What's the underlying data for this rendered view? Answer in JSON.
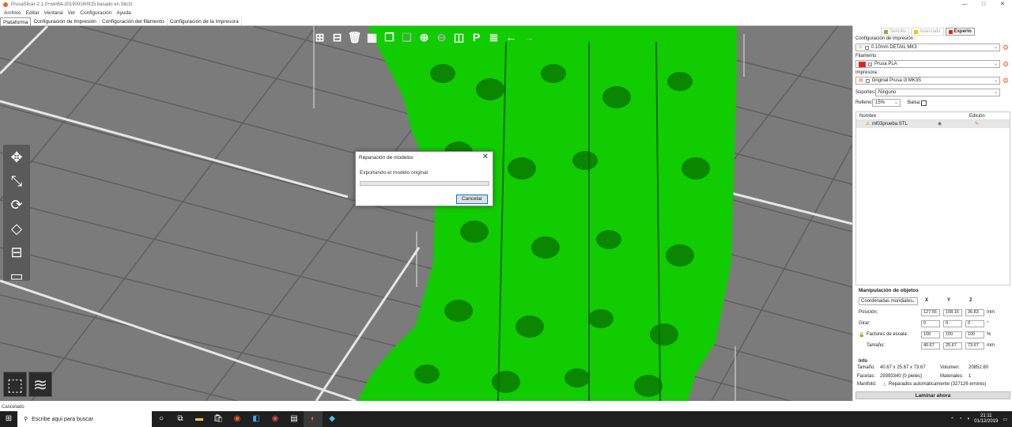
{
  "window": {
    "title": "PrusaSlicer-2.1.0+win64-201909160915 basado en Slic3r"
  },
  "menu": [
    "Archivo",
    "Editar",
    "Ventana",
    "Ver",
    "Configuración",
    "Ayuda"
  ],
  "tabs": [
    "Plataforma",
    "Configuración de Impresión",
    "Configuración del filamento",
    "Configuración de la Impresora"
  ],
  "dialog": {
    "title": "Reparación de modelos",
    "message": "Exportando el modelo original",
    "progress": 0,
    "cancel_label": "Cancelar"
  },
  "status": "Cancelado",
  "panel": {
    "modes": [
      {
        "label": "Sencillo",
        "color": "#6fbe42"
      },
      {
        "label": "Avanzado",
        "color": "#f2c200"
      },
      {
        "label": "Experto",
        "color": "#e0261a"
      }
    ],
    "print_settings_label": "Configuración de impresión :",
    "print_settings_value": "0.10mm DETAIL MK3",
    "filament_label": "Filamento :",
    "filament_value": "Prusa PLA",
    "filament_color": "#e0261a",
    "printer_label": "Impresora :",
    "printer_value": "Original Prusa i3 MK3S",
    "supports_label": "Soportes:",
    "supports_value": "Ninguno",
    "infill_label": "Relleno:",
    "infill_value": "15%",
    "brim_label": "Balsa:",
    "list_header_name": "Nombre",
    "list_header_edit": "Edición",
    "object_name": "mf03prueba.STL"
  },
  "manipulation": {
    "title": "Manipulación de objetos",
    "coords": "Coordenadas mundiales",
    "axes": [
      "X",
      "Y",
      "Z"
    ],
    "position_label": "Posición:",
    "position": [
      "127.55",
      "108.16",
      "36.83"
    ],
    "position_unit": "mm",
    "rotate_label": "Girar:",
    "rotate": [
      "0",
      "0",
      "0"
    ],
    "rotate_unit": "°",
    "scale_label": "Factores de escala:",
    "scale": [
      "100",
      "100",
      "100"
    ],
    "scale_unit": "%",
    "size_label": "Tamaño:",
    "size": [
      "40.67",
      "25.67",
      "73.67"
    ],
    "size_unit": "mm"
  },
  "info": {
    "title": "Info",
    "size_label": "Tamaño:",
    "size_value": "40.67 x 25.67 x 73.67",
    "volume_label": "Volumen:",
    "volume_value": "20852.60",
    "facets_label": "Facetas:",
    "facets_value": "29393340 (0 pieles)",
    "materials_label": "Materiales:",
    "materials_value": "1",
    "manifold_label": "Manifold:",
    "manifold_value": "Reparados automáticamente (327126 errores)"
  },
  "slice_button": "Laminar ahora",
  "taskbar": {
    "search_placeholder": "Escribe aquí para buscar",
    "time": "21:11",
    "date": "01/12/2019"
  },
  "colors": {
    "model": "#11cc00",
    "bed": "#7b7b7b",
    "accent": "#e8632a"
  }
}
